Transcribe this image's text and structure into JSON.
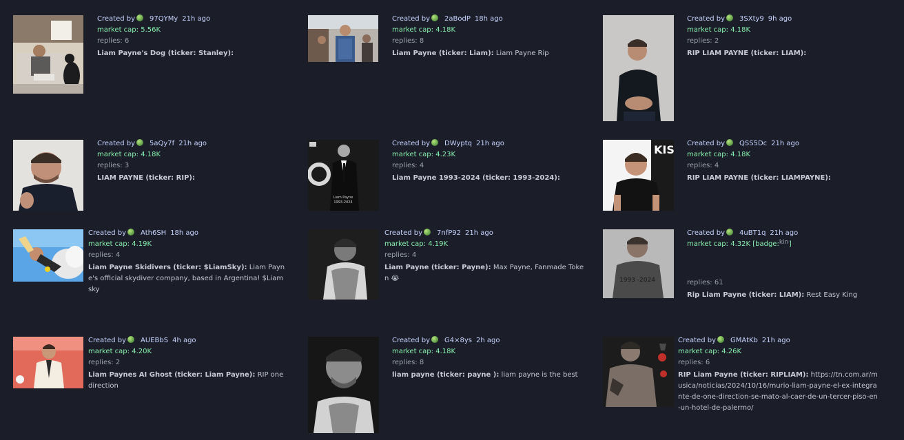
{
  "created_by_label": "Created by",
  "market_cap_label": "market cap:",
  "replies_label": "replies:",
  "cards": [
    {
      "user": "97QYMy",
      "ago": "21h ago",
      "mcap": "5.56K",
      "replies": "6",
      "name_ticker": "Liam Payne's Dog (ticker: Stanley):",
      "desc": ""
    },
    {
      "user": "2aBodP",
      "ago": "18h ago",
      "mcap": "4.18K",
      "replies": "8",
      "name_ticker": "Liam Payne (ticker: Liam):",
      "desc": "Liam Payne Rip"
    },
    {
      "user": "3SXty9",
      "ago": "9h ago",
      "mcap": "4.18K",
      "replies": "2",
      "name_ticker": "RIP LIAM PAYNE (ticker: LIAM):",
      "desc": ""
    },
    {
      "user": "5aQy7f",
      "ago": "21h ago",
      "mcap": "4.18K",
      "replies": "3",
      "name_ticker": "LIAM PAYNE (ticker: RIP):",
      "desc": ""
    },
    {
      "user": "DWyptq",
      "ago": "21h ago",
      "mcap": "4.23K",
      "replies": "4",
      "name_ticker": "Liam Payne 1993-2024 (ticker: 1993-2024):",
      "desc": ""
    },
    {
      "user": "QSS5Dc",
      "ago": "21h ago",
      "mcap": "4.18K",
      "replies": "4",
      "name_ticker": "RIP LIAM PAYNE (ticker: LIAMPAYNE):",
      "desc": ""
    },
    {
      "user": "Ath6SH",
      "ago": "18h ago",
      "mcap": "4.19K",
      "replies": "4",
      "name_ticker": "Liam Payne Skidivers (ticker: $LiamSky):",
      "desc": "Liam Payne's official skydiver company, based in Argentina! $Liamsky"
    },
    {
      "user": "7nfP92",
      "ago": "21h ago",
      "mcap": "4.19K",
      "replies": "4",
      "name_ticker": "Liam Payne (ticker: Payne):",
      "desc": "Max Payne, Fanmade Token 😭"
    },
    {
      "user": "4uBT1q",
      "ago": "21h ago",
      "mcap": "4.32K",
      "replies": "61",
      "name_ticker": "Rip Liam Payne (ticker: LIAM):",
      "desc": "Rest Easy King",
      "badge": "[badge:",
      "badge_alt": "king of the hill badge",
      "badge_close": "]"
    },
    {
      "user": "AUEBbS",
      "ago": "4h ago",
      "mcap": "4.20K",
      "replies": "2",
      "name_ticker": "Liam Paynes AI Ghost (ticker: Liam Payne):",
      "desc": "RIP one direction"
    },
    {
      "user": "G4×8ys",
      "ago": "2h ago",
      "mcap": "4.18K",
      "replies": "8",
      "name_ticker": "liam payne (ticker: payne ):",
      "desc": "liam payne is the best"
    },
    {
      "user": "GMAtKb",
      "ago": "21h ago",
      "mcap": "4.26K",
      "replies": "6",
      "name_ticker": "RIP Liam Payne (ticker: RIPLIAM):",
      "desc": "https://tn.com.ar/musica/noticias/2024/10/16/murio-liam-payne-el-ex-integrante-de-one-direction-se-mato-al-caer-de-un-tercer-piso-en-un-hotel-de-palermo/"
    }
  ],
  "image_text": {
    "card5_caption_1": "Liam Payne",
    "card5_caption_2": "1993-2024",
    "card6_sign": "KISS",
    "card9_overlay": "1993 -2024"
  },
  "colors": {
    "background": "#1b1d28",
    "created_text": "#c6d4ff",
    "market_cap": "#86efac",
    "muted": "#9ca3af"
  }
}
